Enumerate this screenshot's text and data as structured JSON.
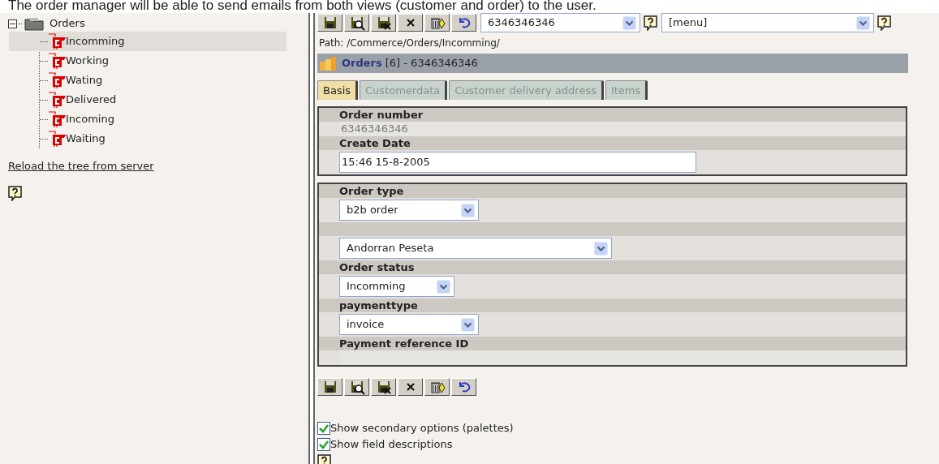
{
  "caption": "The order manager will be able to send emails from both views (customer and order) to the user.",
  "tree": {
    "label": "Orders",
    "expanded": true,
    "children": [
      {
        "label": "Incomming",
        "selected": true
      },
      {
        "label": "Working",
        "selected": false
      },
      {
        "label": "Wating",
        "selected": false
      },
      {
        "label": "Delivered",
        "selected": false
      },
      {
        "label": "Incoming",
        "selected": false
      },
      {
        "label": "Waiting",
        "selected": false
      }
    ]
  },
  "reload_link": "Reload the tree from server",
  "record_select": "6346346346",
  "menu_select": "[menu]",
  "path": "Path: /Commerce/Orders/Incomming/",
  "header": {
    "title": "Orders",
    "detail": "[6] - 6346346346"
  },
  "tabs": [
    {
      "label": "Basis",
      "selected": true
    },
    {
      "label": "Customerdata",
      "selected": false
    },
    {
      "label": "Customer delivery address",
      "selected": false
    },
    {
      "label": "Items",
      "selected": false
    }
  ],
  "sections": [
    {
      "fields": [
        {
          "label": "Order number",
          "kind": "readonly",
          "value": "6346346346"
        },
        {
          "label": "Create Date",
          "kind": "text",
          "value": "15:46 15-8-2005"
        }
      ]
    },
    {
      "fields": [
        {
          "label": "Order type",
          "kind": "select",
          "value": "b2b order"
        },
        {
          "kind": "select",
          "value": "Andorran Peseta"
        },
        {
          "label": "Order status",
          "kind": "select",
          "value": "Incomming"
        },
        {
          "label": "paymenttype",
          "kind": "select",
          "value": "invoice"
        },
        {
          "label": "Payment reference ID",
          "kind": "readonly"
        }
      ]
    }
  ],
  "options": [
    {
      "label": "Show secondary options (palettes)",
      "checked": true
    },
    {
      "label": "Show field descriptions",
      "checked": true
    }
  ]
}
